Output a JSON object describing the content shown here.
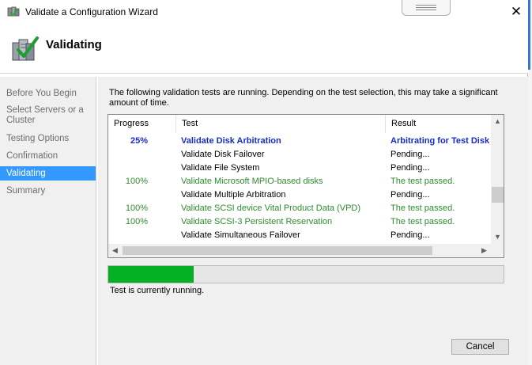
{
  "window": {
    "title": "Validate a Configuration Wizard",
    "close_glyph": "✕"
  },
  "header": {
    "title": "Validating"
  },
  "sidebar": {
    "items": [
      {
        "label": "Before You Begin"
      },
      {
        "label": "Select Servers or a Cluster"
      },
      {
        "label": "Testing Options"
      },
      {
        "label": "Confirmation"
      },
      {
        "label": "Validating",
        "active": true
      },
      {
        "label": "Summary"
      }
    ]
  },
  "main": {
    "description": "The following validation tests are running. Depending on the test selection, this may take a significant amount of time.",
    "table": {
      "columns": [
        "Progress",
        "Test",
        "Result"
      ],
      "rows": [
        {
          "progress": "25%",
          "test": "Validate Disk Arbitration",
          "result": "Arbitrating for Test Disk",
          "state": "running"
        },
        {
          "progress": "",
          "test": "Validate Disk Failover",
          "result": "Pending...",
          "state": "pending"
        },
        {
          "progress": "",
          "test": "Validate File System",
          "result": "Pending...",
          "state": "pending"
        },
        {
          "progress": "100%",
          "test": "Validate Microsoft MPIO-based disks",
          "result": "The test passed.",
          "state": "passed"
        },
        {
          "progress": "",
          "test": "Validate Multiple Arbitration",
          "result": "Pending...",
          "state": "pending"
        },
        {
          "progress": "100%",
          "test": "Validate SCSI device Vital Product Data (VPD)",
          "result": "The test passed.",
          "state": "passed"
        },
        {
          "progress": "100%",
          "test": "Validate SCSI-3 Persistent Reservation",
          "result": "The test passed.",
          "state": "passed"
        },
        {
          "progress": "",
          "test": "Validate Simultaneous Failover",
          "result": "Pending...",
          "state": "pending"
        }
      ]
    },
    "progress_fraction": 0.215,
    "status": "Test is currently running."
  },
  "footer": {
    "cancel_label": "Cancel"
  },
  "colors": {
    "running": "#1a2cc7",
    "passed": "#2e8b2e",
    "progress_fill": "#06b025",
    "selected": "#3399ff"
  },
  "icons": {
    "title": "cluster-server-icon",
    "header": "validation-checkmark-icon"
  }
}
